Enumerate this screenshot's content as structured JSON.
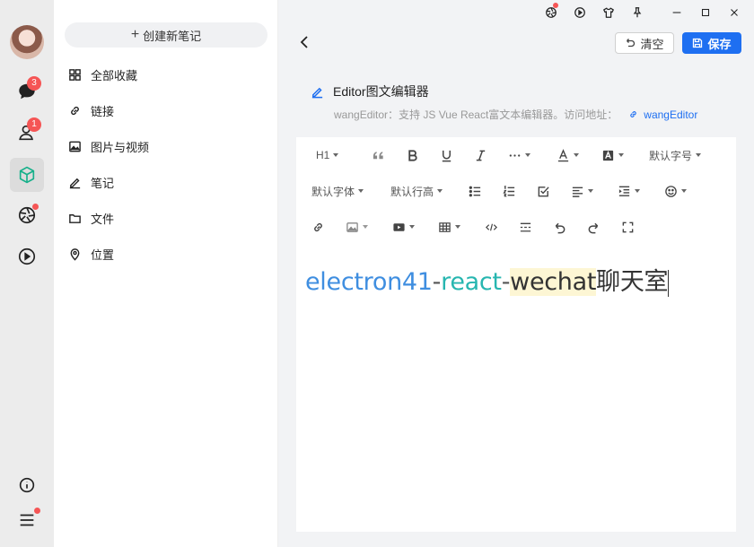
{
  "rail": {
    "chat_badge": "3",
    "contacts_badge": "1"
  },
  "nav": {
    "create_label": "创建新笔记",
    "items": [
      {
        "label": "全部收藏",
        "icon": "grid-icon"
      },
      {
        "label": "链接",
        "icon": "link-icon"
      },
      {
        "label": "图片与视频",
        "icon": "image-icon"
      },
      {
        "label": "笔记",
        "icon": "pen-icon"
      },
      {
        "label": "文件",
        "icon": "folder-icon"
      },
      {
        "label": "位置",
        "icon": "location-icon"
      }
    ]
  },
  "header": {
    "clear_label": "清空",
    "save_label": "保存"
  },
  "doc": {
    "title": "Editor图文编辑器",
    "description": "wangEditor：支持 JS Vue React富文本编辑器。访问地址：",
    "link_text": "wangEditor"
  },
  "toolbar": {
    "heading": "H1",
    "font_size": "默认字号",
    "font_family": "默认字体",
    "line_height": "默认行高"
  },
  "content": {
    "seg1": "electron41",
    "seg2": "-",
    "seg3": "react",
    "seg4": "-",
    "seg5": "wechat",
    "seg6": "聊天室"
  },
  "colors": {
    "primary": "#1e6ff1",
    "badge": "#f55555",
    "text_blue": "#3f8ee0",
    "text_teal": "#27b6b0",
    "highlight": "#fdf6d4"
  }
}
